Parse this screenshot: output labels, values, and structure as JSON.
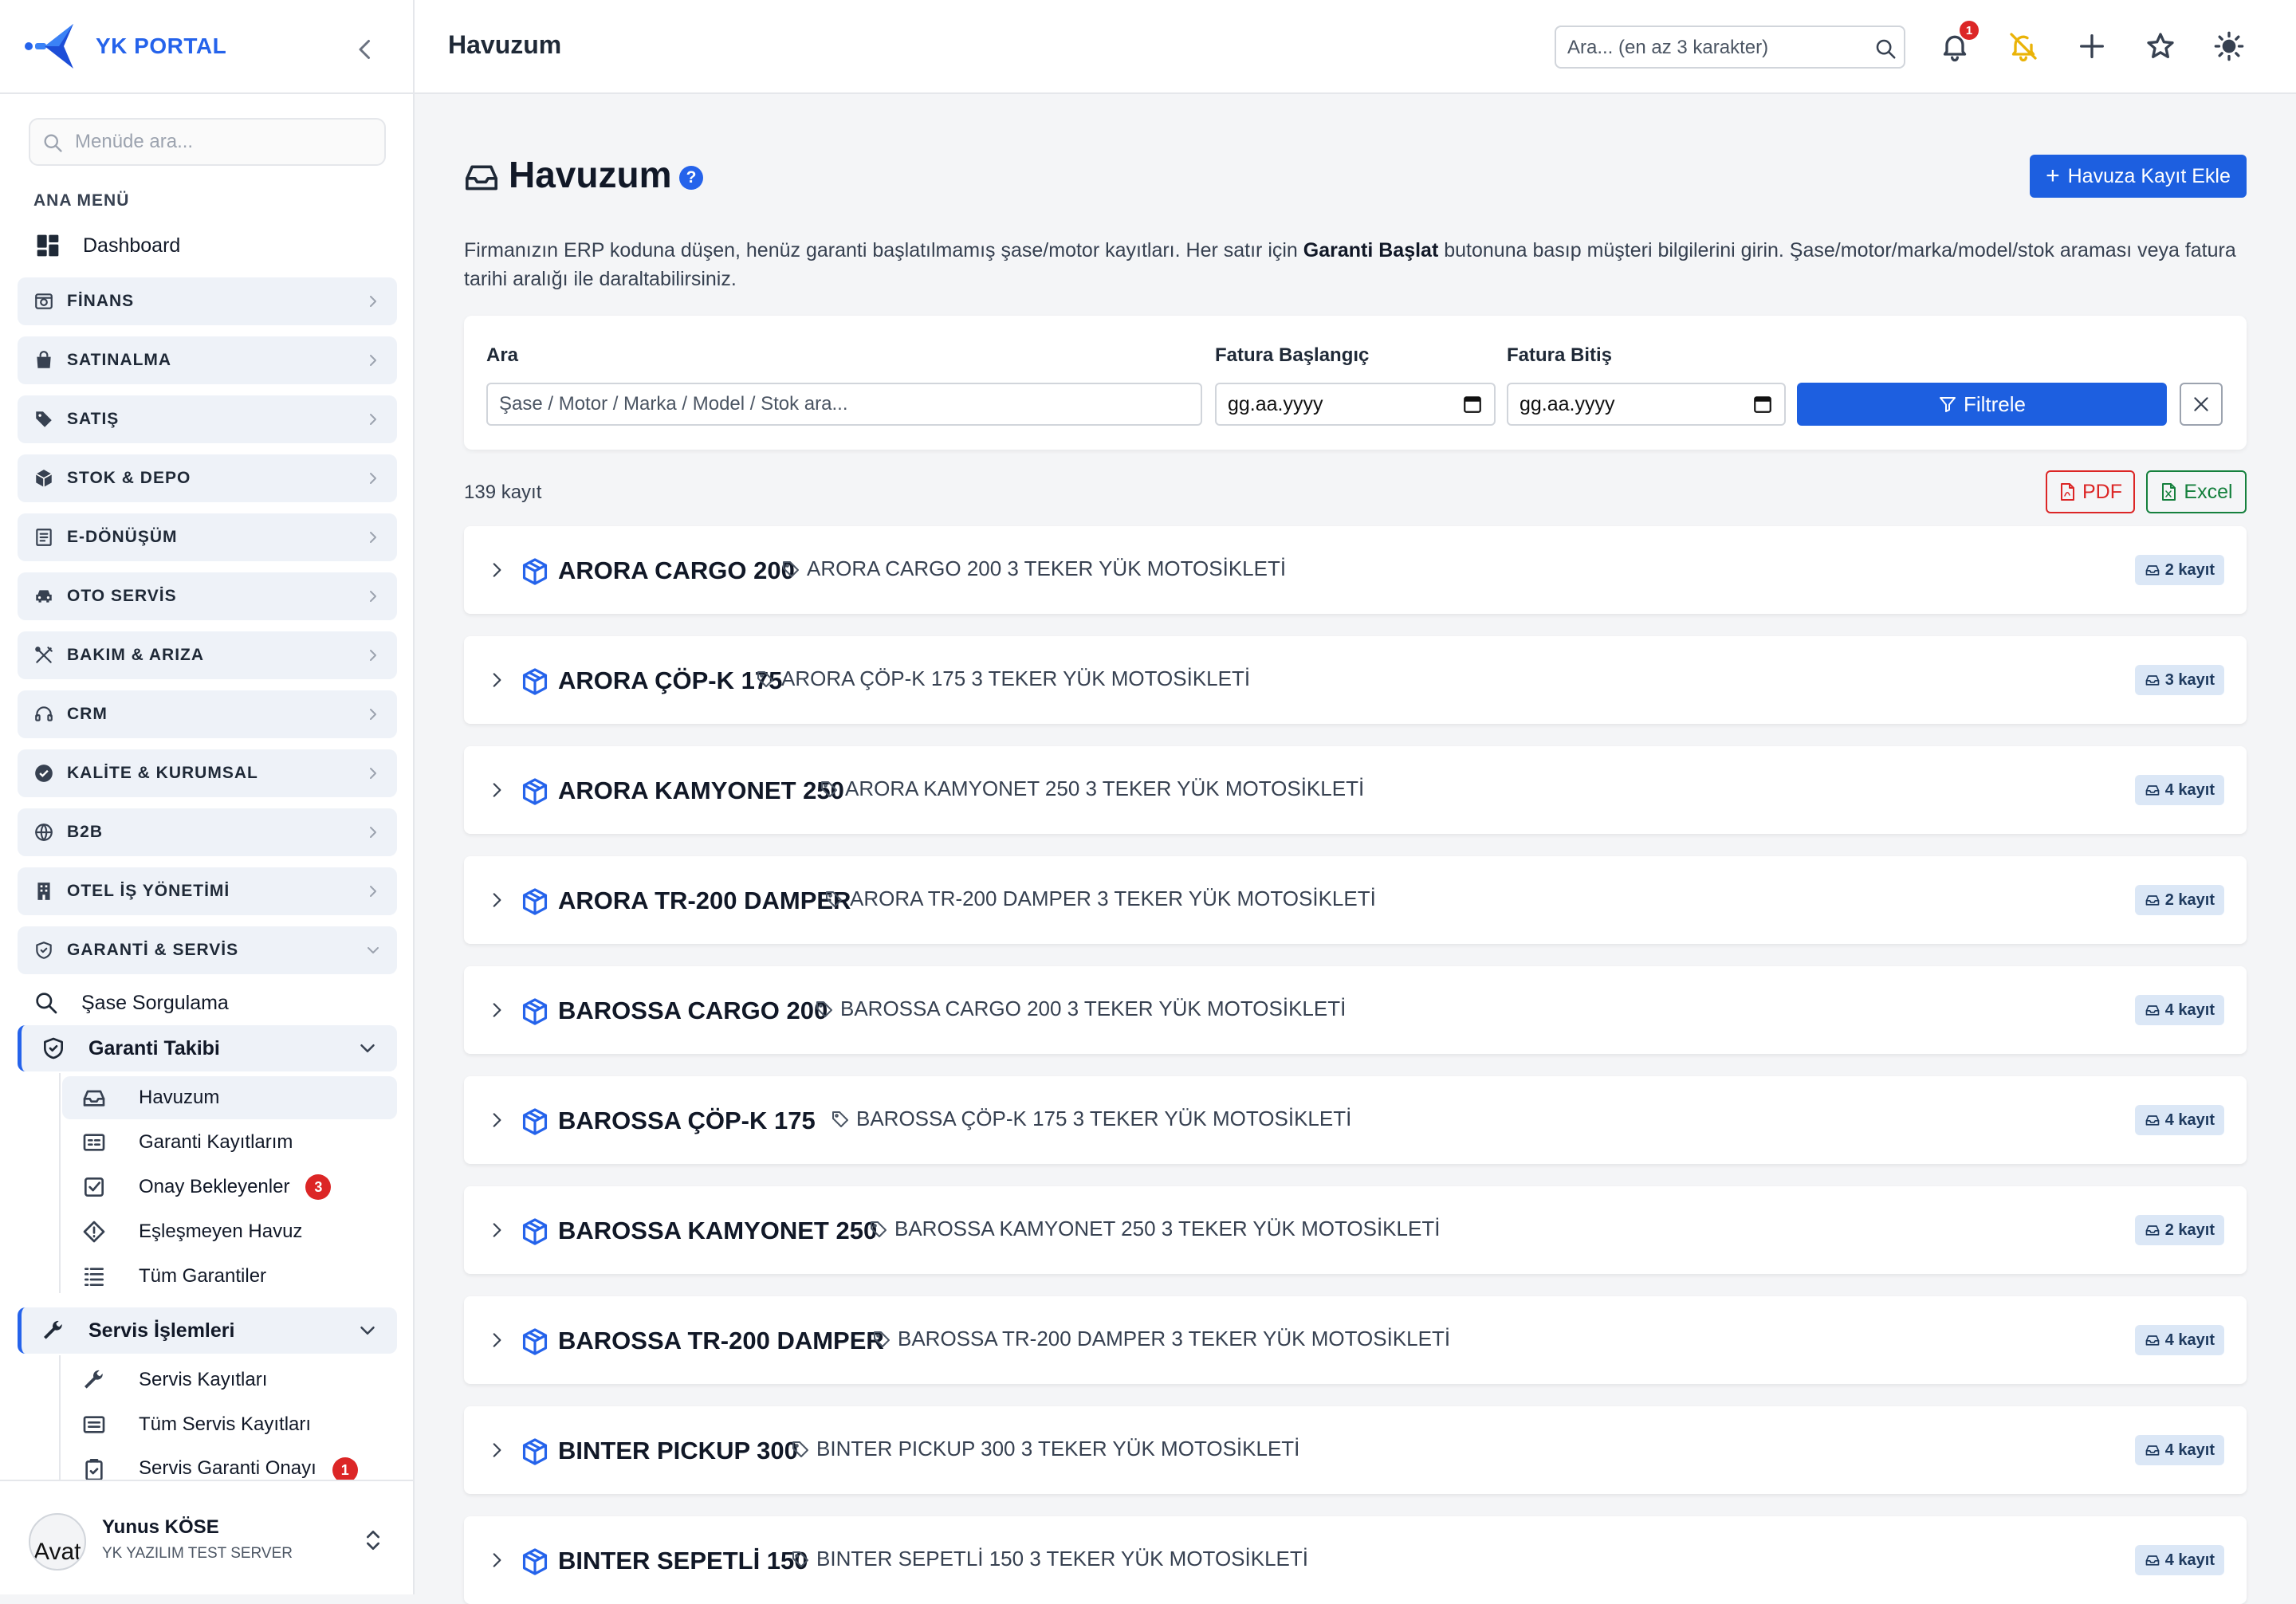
{
  "app": {
    "brand": "YK PORTAL",
    "page_title": "Havuzum"
  },
  "sidebar": {
    "search_placeholder": "Menüde ara...",
    "section_label": "ANA MENÜ",
    "dashboard": "Dashboard",
    "categories": [
      {
        "label": "FİNANS",
        "icon": "finance-icon"
      },
      {
        "label": "SATINALMA",
        "icon": "bag-icon"
      },
      {
        "label": "SATIŞ",
        "icon": "tag-icon"
      },
      {
        "label": "STOK & DEPO",
        "icon": "box-icon"
      },
      {
        "label": "E-DÖNÜŞÜM",
        "icon": "document-icon"
      },
      {
        "label": "OTO SERVİS",
        "icon": "car-icon"
      },
      {
        "label": "BAKIM & ARIZA",
        "icon": "tools-icon"
      },
      {
        "label": "CRM",
        "icon": "headset-icon"
      },
      {
        "label": "KALİTE & KURUMSAL",
        "icon": "badge-check-icon"
      },
      {
        "label": "B2B",
        "icon": "globe-icon"
      },
      {
        "label": "OTEL İŞ YÖNETİMİ",
        "icon": "building-icon"
      },
      {
        "label": "GARANTİ & SERVİS",
        "icon": "shield-icon"
      }
    ],
    "chassis_query": "Şase Sorgulama",
    "warranty_tracking": {
      "label": "Garanti Takibi",
      "items": [
        {
          "label": "Havuzum",
          "active": true
        },
        {
          "label": "Garanti Kayıtlarım"
        },
        {
          "label": "Onay Bekleyenler",
          "badge": "3"
        },
        {
          "label": "Eşleşmeyen Havuz"
        },
        {
          "label": "Tüm Garantiler"
        }
      ]
    },
    "service_ops": {
      "label": "Servis İşlemleri",
      "items": [
        {
          "label": "Servis Kayıtları"
        },
        {
          "label": "Tüm Servis Kayıtları"
        },
        {
          "label": "Servis Garanti Onayı",
          "badge": "1"
        }
      ]
    },
    "user": {
      "name": "Yunus KÖSE",
      "org": "YK YAZILIM TEST SERVER",
      "avatar_alt": "Avat"
    }
  },
  "topbar": {
    "search_placeholder": "Ara... (en az 3 karakter)",
    "notification_count": "1"
  },
  "main": {
    "heading": "Havuzum",
    "help": "?",
    "add_button": "Havuza Kayıt Ekle",
    "description_1": "Firmanızın ERP koduna düşen, henüz garanti başlatılmamış şase/motor kayıtları. Her satır için ",
    "description_bold": "Garanti Başlat",
    "description_2": " butonuna basıp müşteri bilgilerini girin. Şase/motor/marka/model/stok araması veya fatura tarihi aralığı ile daraltabilirsiniz.",
    "filters": {
      "search_label": "Ara",
      "search_placeholder": "Şase / Motor / Marka / Model / Stok ara...",
      "start_label": "Fatura Başlangıç",
      "start_value": "gg.aa.yyyy",
      "end_label": "Fatura Bitiş",
      "end_value": "gg.aa.yyyy",
      "filter_button": "Filtrele"
    },
    "record_count": "139 kayıt",
    "export": {
      "pdf": "PDF",
      "excel": "Excel"
    },
    "groups": [
      {
        "name": "ARORA CARGO 200",
        "desc": "ARORA CARGO 200 3 TEKER YÜK MOTOSİKLETİ",
        "count": "2 kayıt"
      },
      {
        "name": "ARORA ÇÖP-K 175",
        "desc": "ARORA ÇÖP-K 175 3 TEKER YÜK MOTOSİKLETİ",
        "count": "3 kayıt"
      },
      {
        "name": "ARORA KAMYONET 250",
        "desc": "ARORA KAMYONET 250 3 TEKER YÜK MOTOSİKLETİ",
        "count": "4 kayıt"
      },
      {
        "name": "ARORA TR-200 DAMPER",
        "desc": "ARORA TR-200 DAMPER 3 TEKER YÜK MOTOSİKLETİ",
        "count": "2 kayıt"
      },
      {
        "name": "BAROSSA CARGO 200",
        "desc": "BAROSSA CARGO 200 3 TEKER YÜK MOTOSİKLETİ",
        "count": "4 kayıt"
      },
      {
        "name": "BAROSSA ÇÖP-K 175",
        "desc": "BAROSSA ÇÖP-K 175 3 TEKER YÜK MOTOSİKLETİ",
        "count": "4 kayıt"
      },
      {
        "name": "BAROSSA KAMYONET 250",
        "desc": "BAROSSA KAMYONET 250 3 TEKER YÜK MOTOSİKLETİ",
        "count": "2 kayıt"
      },
      {
        "name": "BAROSSA TR-200 DAMPER",
        "desc": "BAROSSA TR-200 DAMPER 3 TEKER YÜK MOTOSİKLETİ",
        "count": "4 kayıt"
      },
      {
        "name": "BINTER PICKUP 300",
        "desc": "BINTER PICKUP 300 3 TEKER YÜK MOTOSİKLETİ",
        "count": "4 kayıt"
      },
      {
        "name": "BINTER SEPETLİ 150",
        "desc": "BINTER SEPETLİ 150 3 TEKER YÜK MOTOSİKLETİ",
        "count": "4 kayıt"
      }
    ]
  }
}
